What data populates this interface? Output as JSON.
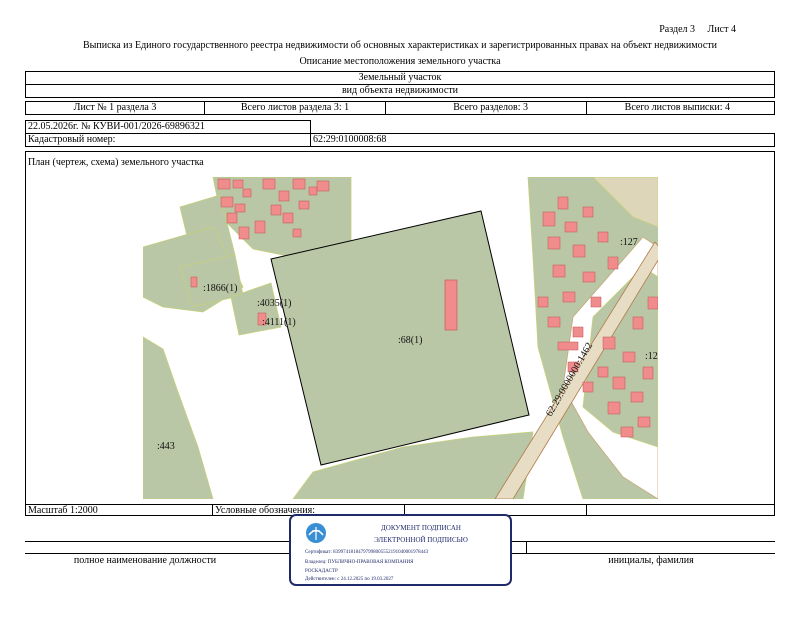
{
  "header": {
    "section": "Раздел 3",
    "sheet": "Лист 4",
    "title": "Выписка из Единого государственного реестра недвижимости об основных характеристиках и зарегистрированных правах на объект недвижимости",
    "subtitle": "Описание местоположения земельного участка"
  },
  "object": {
    "type": "Земельный участок",
    "type_caption": "вид объекта недвижимости"
  },
  "sheets": {
    "sheet_no": "Лист № 1 раздела 3",
    "total_section": "Всего листов раздела 3: 1",
    "total_sections": "Всего разделов: 3",
    "total_sheets": "Всего листов выписки: 4"
  },
  "record": {
    "date_number": "22.05.2026г. № КУВИ-001/2026-69896321",
    "cadastral_label": "Кадастровый номер:",
    "cadastral_value": "62:29:0100008:68"
  },
  "plan": {
    "label": "План (чертеж, схема) земельного участка",
    "labels": {
      "main": ":68(1)",
      "p1866": ":1866(1)",
      "p4035": ":4035(1)",
      "p4111": ":4111(1)",
      "p443": ":443",
      "p127": ":127",
      "p12": ":12",
      "road": "62:29:0000000:1462"
    }
  },
  "scale": {
    "label": "Масштаб 1:2000",
    "legend_label": "Условные обозначения:"
  },
  "footer": {
    "position": "полное наименование должности",
    "initials": "инициалы, фамилия"
  },
  "stamp": {
    "line1": "ДОКУМЕНТ ПОДПИСАН",
    "line2": "ЭЛЕКТРОННОЙ ПОДПИСЬЮ",
    "certificate": "Сертификат: 83997418184797998005552191040001978443",
    "owner": "Владелец: ПУБЛИЧНО-ПРАВОВАЯ КОМПАНИЯ",
    "owner2": "РОСКАДАСТР",
    "valid": "Действителен: с 24.12.2025 по 19.03.2027"
  },
  "colors": {
    "parcel_fill": "#b9c7a6",
    "building_fill": "#f08c8c",
    "border": "#000000",
    "stamp_border": "#1f2a6b"
  }
}
